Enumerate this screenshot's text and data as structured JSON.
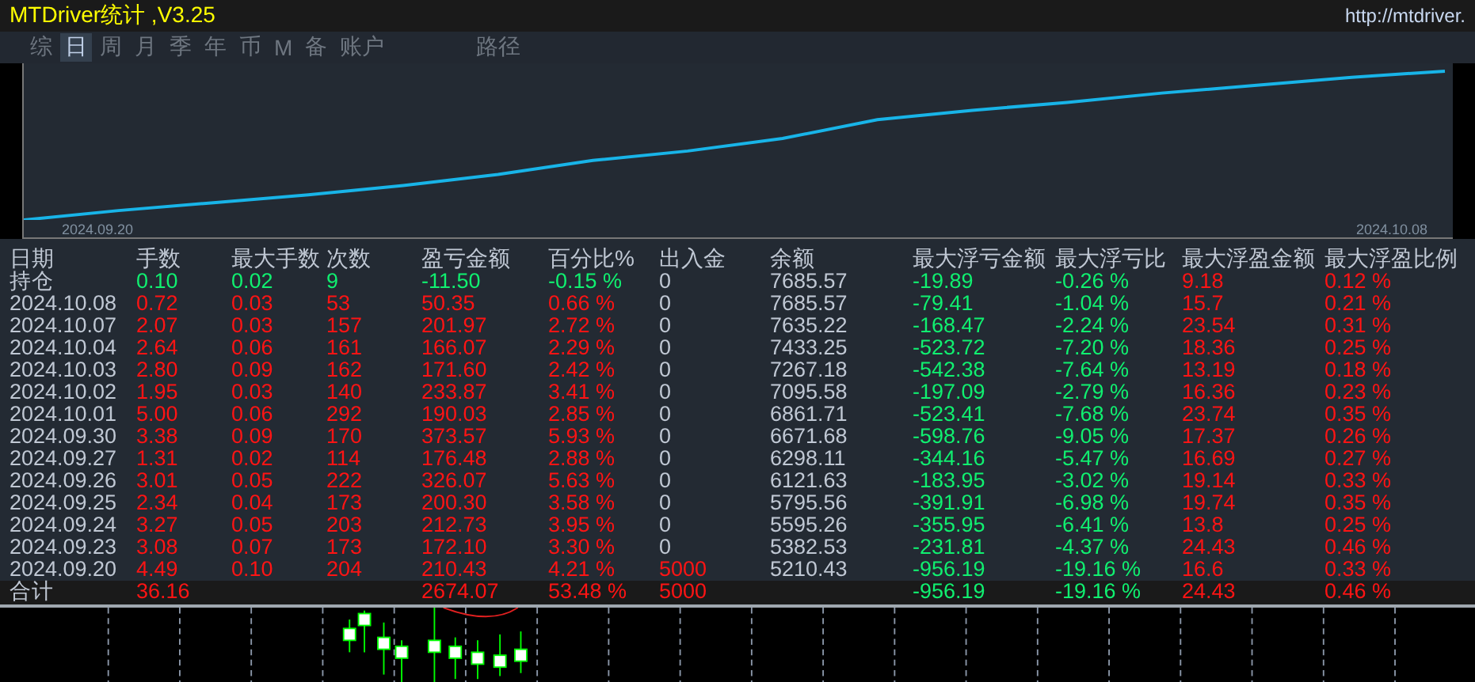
{
  "title": "MTDriver统计 ,V3.25",
  "link": "http://mtdriver.",
  "tabs": [
    {
      "label": "综",
      "selected": false
    },
    {
      "label": "日",
      "selected": true
    },
    {
      "label": "周",
      "selected": false
    },
    {
      "label": "月",
      "selected": false
    },
    {
      "label": "季",
      "selected": false
    },
    {
      "label": "年",
      "selected": false
    },
    {
      "label": "币",
      "selected": false
    },
    {
      "label": "M",
      "selected": false
    },
    {
      "label": "备",
      "selected": false
    },
    {
      "label": "账户",
      "selected": false
    },
    {
      "label": "路径",
      "selected": false
    }
  ],
  "equity_chart": {
    "x_start": "2024.09.20",
    "x_end": "2024.10.08"
  },
  "table": {
    "columns": [
      "日期",
      "手数",
      "最大手数",
      "次数",
      "盈亏金额",
      "百分比%",
      "出入金",
      "余额",
      "最大浮亏金额",
      "最大浮亏比",
      "最大浮盈金额",
      "最大浮盈比例"
    ],
    "rows": [
      {
        "kind": "position",
        "deposit": false,
        "cells": [
          "持仓",
          "0.10",
          "0.02",
          "9",
          "-11.50",
          "-0.15 %",
          "0",
          "7685.57",
          "-19.89",
          "-0.26 %",
          "9.18",
          "0.12 %"
        ]
      },
      {
        "kind": "day",
        "deposit": false,
        "cells": [
          "2024.10.08",
          "0.72",
          "0.03",
          "53",
          "50.35",
          "0.66 %",
          "0",
          "7685.57",
          "-79.41",
          "-1.04 %",
          "15.7",
          "0.21 %"
        ]
      },
      {
        "kind": "day",
        "deposit": false,
        "cells": [
          "2024.10.07",
          "2.07",
          "0.03",
          "157",
          "201.97",
          "2.72 %",
          "0",
          "7635.22",
          "-168.47",
          "-2.24 %",
          "23.54",
          "0.31 %"
        ]
      },
      {
        "kind": "day",
        "deposit": false,
        "cells": [
          "2024.10.04",
          "2.64",
          "0.06",
          "161",
          "166.07",
          "2.29 %",
          "0",
          "7433.25",
          "-523.72",
          "-7.20 %",
          "18.36",
          "0.25 %"
        ]
      },
      {
        "kind": "day",
        "deposit": false,
        "cells": [
          "2024.10.03",
          "2.80",
          "0.09",
          "162",
          "171.60",
          "2.42 %",
          "0",
          "7267.18",
          "-542.38",
          "-7.64 %",
          "13.19",
          "0.18 %"
        ]
      },
      {
        "kind": "day",
        "deposit": false,
        "cells": [
          "2024.10.02",
          "1.95",
          "0.03",
          "140",
          "233.87",
          "3.41 %",
          "0",
          "7095.58",
          "-197.09",
          "-2.79 %",
          "16.36",
          "0.23 %"
        ]
      },
      {
        "kind": "day",
        "deposit": false,
        "cells": [
          "2024.10.01",
          "5.00",
          "0.06",
          "292",
          "190.03",
          "2.85 %",
          "0",
          "6861.71",
          "-523.41",
          "-7.68 %",
          "23.74",
          "0.35 %"
        ]
      },
      {
        "kind": "day",
        "deposit": false,
        "cells": [
          "2024.09.30",
          "3.38",
          "0.09",
          "170",
          "373.57",
          "5.93 %",
          "0",
          "6671.68",
          "-598.76",
          "-9.05 %",
          "17.37",
          "0.26 %"
        ]
      },
      {
        "kind": "day",
        "deposit": false,
        "cells": [
          "2024.09.27",
          "1.31",
          "0.02",
          "114",
          "176.48",
          "2.88 %",
          "0",
          "6298.11",
          "-344.16",
          "-5.47 %",
          "16.69",
          "0.27 %"
        ]
      },
      {
        "kind": "day",
        "deposit": false,
        "cells": [
          "2024.09.26",
          "3.01",
          "0.05",
          "222",
          "326.07",
          "5.63 %",
          "0",
          "6121.63",
          "-183.95",
          "-3.02 %",
          "19.14",
          "0.33 %"
        ]
      },
      {
        "kind": "day",
        "deposit": false,
        "cells": [
          "2024.09.25",
          "2.34",
          "0.04",
          "173",
          "200.30",
          "3.58 %",
          "0",
          "5795.56",
          "-391.91",
          "-6.98 %",
          "19.74",
          "0.35 %"
        ]
      },
      {
        "kind": "day",
        "deposit": false,
        "cells": [
          "2024.09.24",
          "3.27",
          "0.05",
          "203",
          "212.73",
          "3.95 %",
          "0",
          "5595.26",
          "-355.95",
          "-6.41 %",
          "13.8",
          "0.25 %"
        ]
      },
      {
        "kind": "day",
        "deposit": false,
        "cells": [
          "2024.09.23",
          "3.08",
          "0.07",
          "173",
          "172.10",
          "3.30 %",
          "0",
          "5382.53",
          "-231.81",
          "-4.37 %",
          "24.43",
          "0.46 %"
        ]
      },
      {
        "kind": "day",
        "deposit": true,
        "cells": [
          "2024.09.20",
          "4.49",
          "0.10",
          "204",
          "210.43",
          "4.21 %",
          "5000",
          "5210.43",
          "-956.19",
          "-19.16 %",
          "16.6",
          "0.33 %"
        ]
      },
      {
        "kind": "total",
        "deposit": true,
        "cells": [
          "合计",
          "36.16",
          null,
          null,
          "2674.07",
          "53.48 %",
          "5000",
          null,
          "-956.19",
          "-19.16 %",
          "24.43",
          "0.46 %"
        ]
      }
    ]
  }
}
